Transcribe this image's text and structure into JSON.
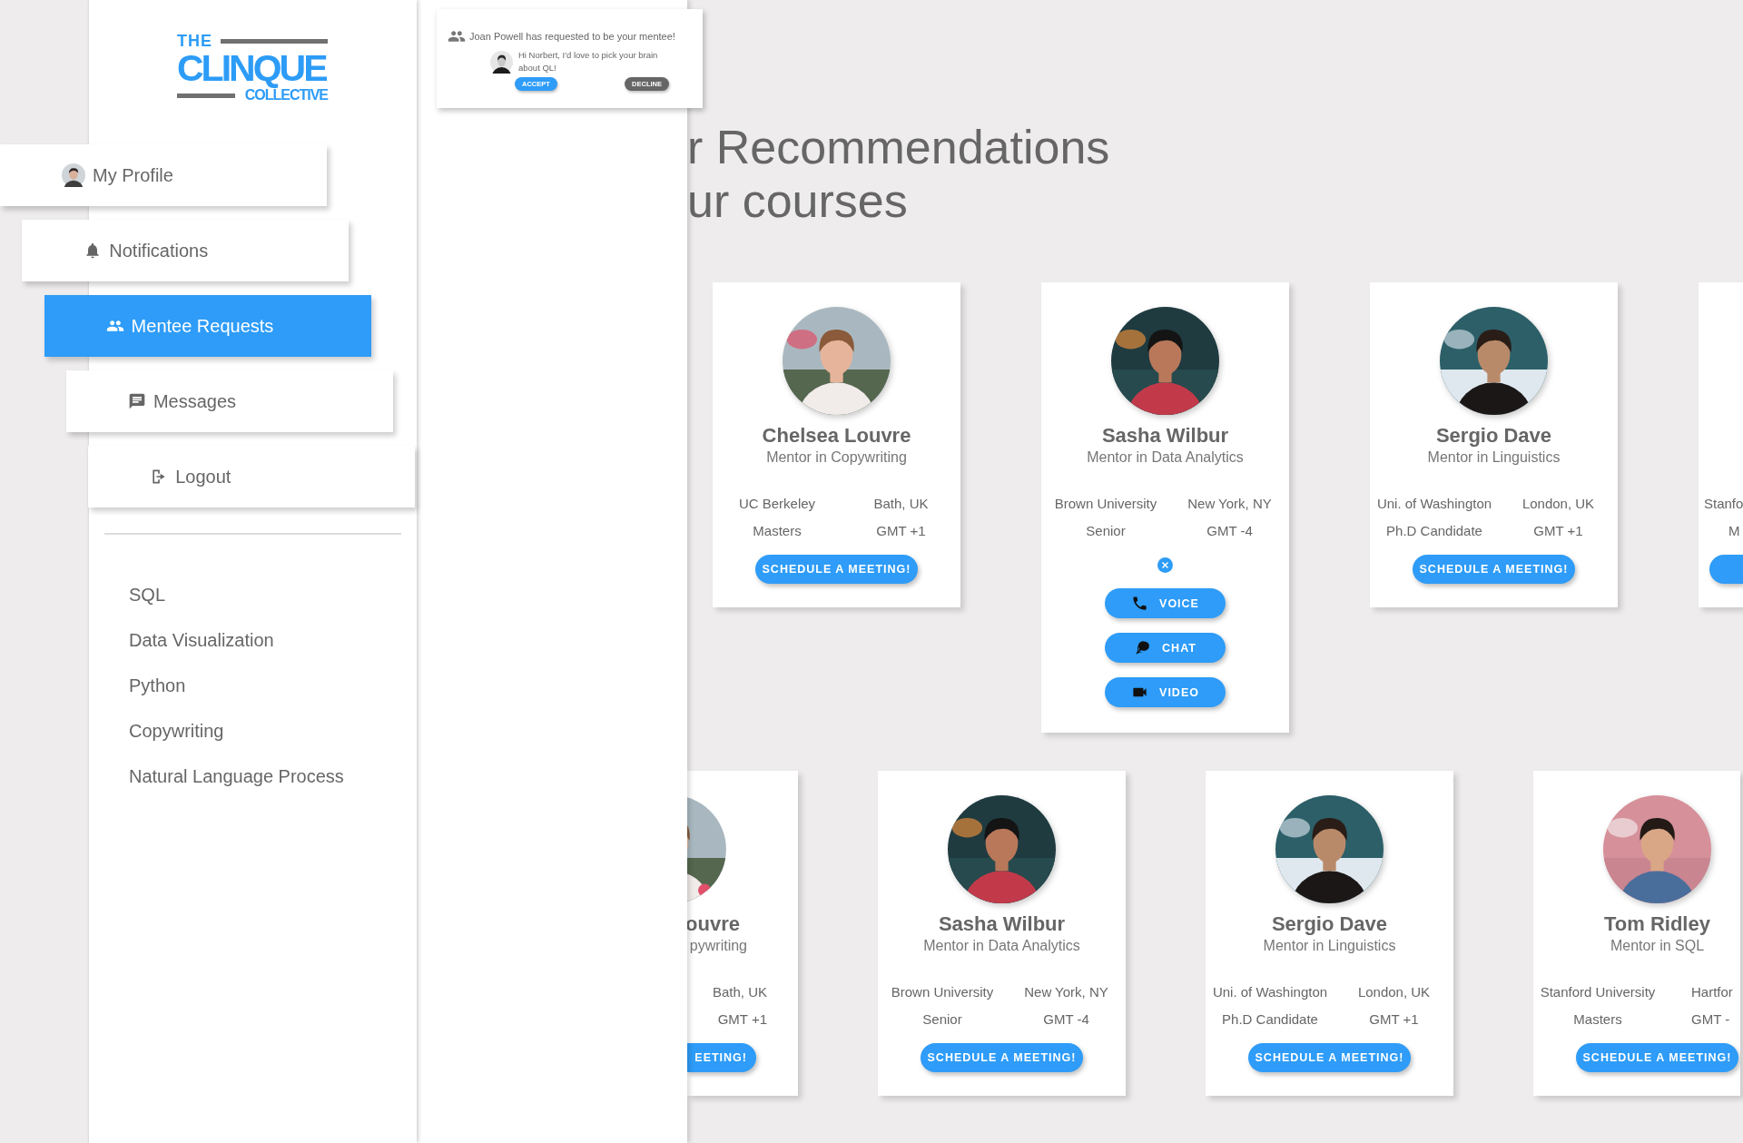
{
  "logo": {
    "top": "THE",
    "main": "CLINQUE",
    "bottom": "COLLECTIVE"
  },
  "menu": [
    {
      "label": "My Profile",
      "selected": false
    },
    {
      "label": "Notifications",
      "selected": false
    },
    {
      "label": "Mentee Requests",
      "selected": true
    },
    {
      "label": "Messages",
      "selected": false
    },
    {
      "label": "Logout",
      "selected": false
    }
  ],
  "courses": [
    "SQL",
    "Data Visualization",
    "Python",
    "Copywriting",
    "Natural Language Process"
  ],
  "notification": {
    "title": "Joan Powell has requested to be your mentee!",
    "message": "Hi Norbert, I'd love to pick your brain about QL!",
    "actions": [
      {
        "label": "ACCEPT",
        "kind": "primary"
      },
      {
        "label": "DECLINE",
        "kind": "secondary"
      }
    ]
  },
  "recommendations": {
    "heading": [
      "r Recommendations",
      "ur courses"
    ],
    "rows": [
      {
        "cards": [
          {
            "kind": "full",
            "name": "Chelsea Louvre",
            "role": "Mentor in Copywriting",
            "school": "UC Berkeley",
            "location": "Bath, UK",
            "level": "Masters",
            "timezone": "GMT +1",
            "button": "SCHEDULE A MEETING!"
          },
          {
            "kind": "contact",
            "name": "Sasha Wilbur",
            "role": "Mentor in Data Analytics",
            "school": "Brown University",
            "location": "New York, NY",
            "level": "Senior",
            "timezone": "GMT -4",
            "options": [
              "VOICE",
              "CHAT",
              "VIDEO"
            ]
          },
          {
            "kind": "full",
            "name": "Sergio Dave",
            "role": "Mentor in Linguistics",
            "school": "Uni. of Washington",
            "location": "London, UK",
            "level": "Ph.D Candidate",
            "timezone": "GMT +1",
            "button": "SCHEDULE A MEETING!"
          },
          {
            "kind": "edge",
            "school": "Stanfo",
            "level": "M"
          }
        ]
      },
      {
        "cards": [
          {
            "kind": "cut-left",
            "name": "ouvre",
            "role": "pywriting",
            "location": "Bath, UK",
            "timezone": "GMT +1",
            "button": "EETING!"
          },
          {
            "kind": "full",
            "name": "Sasha Wilbur",
            "role": "Mentor in Data Analytics",
            "school": "Brown University",
            "location": "New York, NY",
            "level": "Senior",
            "timezone": "GMT -4",
            "button": "SCHEDULE A MEETING!"
          },
          {
            "kind": "full",
            "name": "Sergio Dave",
            "role": "Mentor in Linguistics",
            "school": "Uni. of Washington",
            "location": "London, UK",
            "level": "Ph.D Candidate",
            "timezone": "GMT +1",
            "button": "SCHEDULE A MEETING!"
          },
          {
            "kind": "cut-right",
            "name": "Tom Ridley",
            "role": "Mentor in SQL",
            "school": "Stanford University",
            "location": "Hartfor",
            "level": "Masters",
            "timezone": "GMT -",
            "button": "SCHEDULE A MEETING!"
          }
        ]
      }
    ]
  }
}
